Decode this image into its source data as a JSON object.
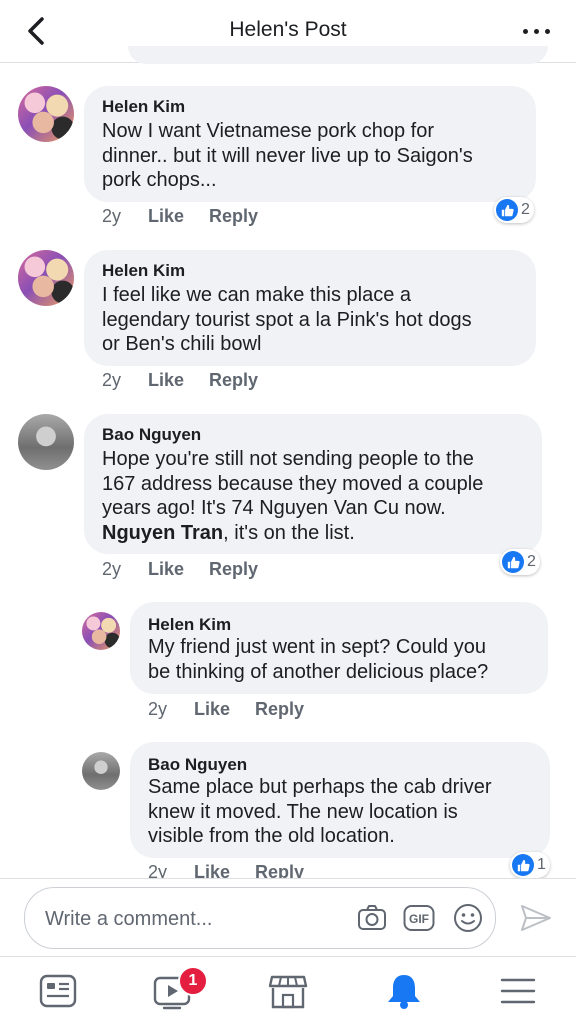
{
  "header": {
    "title": "Helen's Post"
  },
  "comments": [
    {
      "author": "Helen Kim",
      "lines": [
        "Now I want Vietnamese pork chop for",
        "dinner.. but it will never live up to Saigon's",
        "pork chops..."
      ],
      "time": "2y",
      "like": "Like",
      "reply": "Reply",
      "reactions": "2"
    },
    {
      "author": "Helen Kim",
      "lines": [
        "I feel like we can make this place a",
        "legendary tourist spot a la Pink's hot dogs",
        "or Ben's chili bowl"
      ],
      "time": "2y",
      "like": "Like",
      "reply": "Reply"
    },
    {
      "author": "Bao Nguyen",
      "lines": [
        "Hope you're still not sending people to the",
        "167 address because they moved a couple",
        "years ago! It's 74 Nguyen Van Cu now."
      ],
      "mention": "Nguyen Tran",
      "mention_tail": ", it's on the list.",
      "time": "2y",
      "like": "Like",
      "reply": "Reply",
      "reactions": "2"
    }
  ],
  "replies": [
    {
      "author": "Helen Kim",
      "lines": [
        "My friend just went in sept? Could you",
        "be thinking of another delicious place?"
      ],
      "time": "2y",
      "like": "Like",
      "reply": "Reply"
    },
    {
      "author": "Bao Nguyen",
      "lines": [
        "Same place but perhaps the cab driver",
        "knew it moved. The new location is",
        "visible from the old location."
      ],
      "time": "2y",
      "like": "Like",
      "reply": "Reply",
      "reactions": "1"
    }
  ],
  "composer": {
    "placeholder": "Write a comment..."
  },
  "bottom_nav": {
    "watch_badge": "1"
  },
  "colors": {
    "accent": "#1877f2",
    "bubble": "#f0f2f5",
    "badge": "#e41e3f"
  },
  "icons": [
    "back-icon",
    "more-icon",
    "camera-icon",
    "gif-icon",
    "emoji-icon",
    "send-icon",
    "news-feed-icon",
    "watch-icon",
    "marketplace-icon",
    "notifications-icon",
    "menu-icon",
    "like-icon"
  ]
}
